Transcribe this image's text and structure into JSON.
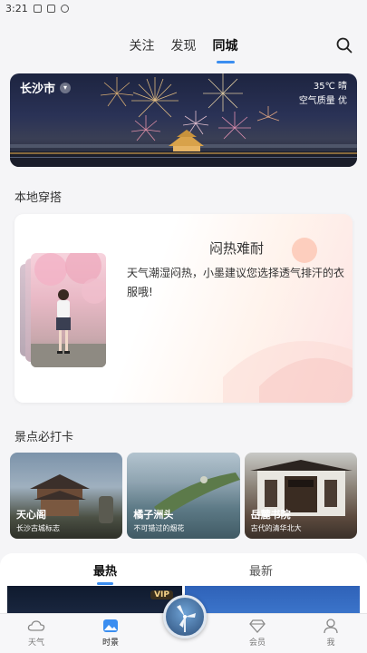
{
  "status_bar": {
    "time": "3:21"
  },
  "top_tabs": [
    {
      "label": "关注"
    },
    {
      "label": "发现"
    },
    {
      "label": "同城",
      "active": true
    }
  ],
  "hero": {
    "city": "长沙市",
    "weather": "35℃ 晴",
    "air_quality": "空气质量 优"
  },
  "local_outfit": {
    "section_title": "本地穿搭",
    "card_title": "闷热难耐",
    "card_text": "天气潮湿闷热，小墨建议您选择透气排汗的衣服哦!"
  },
  "spots": {
    "section_title": "景点必打卡",
    "items": [
      {
        "name": "天心阁",
        "sub": "长沙古城标志"
      },
      {
        "name": "橘子洲头",
        "sub": "不可错过的烟花"
      },
      {
        "name": "岳麓书院",
        "sub": "古代的清华北大"
      }
    ]
  },
  "feed": {
    "tabs": [
      {
        "label": "最热",
        "active": true
      },
      {
        "label": "最新"
      }
    ],
    "badge": "VIP"
  },
  "bottom_nav": [
    {
      "label": "天气",
      "icon": "cloud-icon"
    },
    {
      "label": "时景",
      "icon": "picture-icon",
      "active": true
    },
    {
      "label": "会员",
      "icon": "diamond-icon"
    },
    {
      "label": "我",
      "icon": "person-icon"
    }
  ],
  "colors": {
    "accent": "#3b8ef0"
  }
}
